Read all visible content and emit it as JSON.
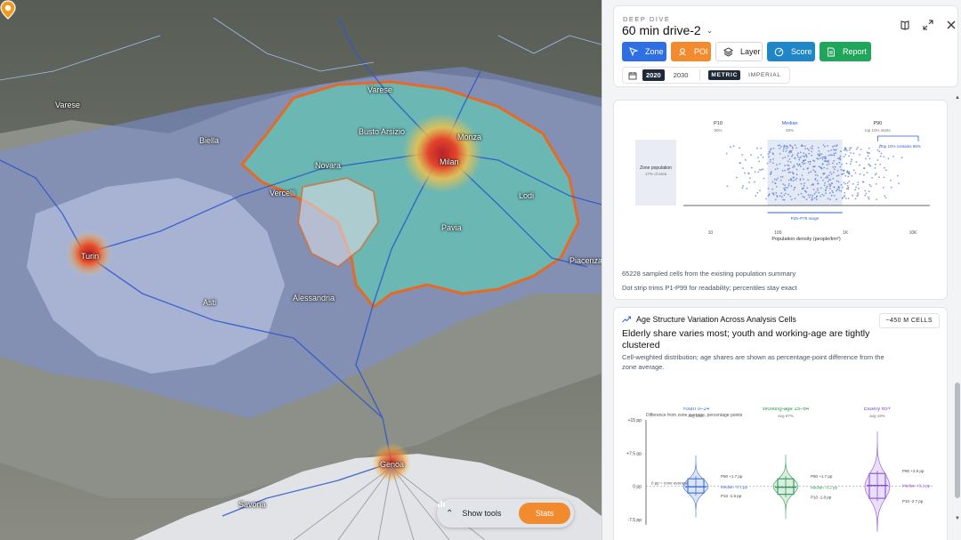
{
  "map": {
    "cities": [
      {
        "name": "Milan",
        "label": "Milan"
      },
      {
        "name": "Turin",
        "label": "Turin"
      },
      {
        "name": "Genoa",
        "label": "Genoa"
      },
      {
        "name": "Novara",
        "label": "Novara"
      },
      {
        "name": "Varese",
        "label": "Varese"
      },
      {
        "name": "Monza",
        "label": "Monza"
      },
      {
        "name": "Busto Arsizio",
        "label": "Busto Arsizio"
      },
      {
        "name": "Vercelli",
        "label": "Vercelli"
      },
      {
        "name": "Lodi",
        "label": "Lodi"
      },
      {
        "name": "Pavia",
        "label": "Pavia"
      },
      {
        "name": "Asti",
        "label": "Asti"
      },
      {
        "name": "Alessandria",
        "label": "Alessandria"
      },
      {
        "name": "Piacenza",
        "label": "Piacenza"
      },
      {
        "name": "Savona",
        "label": "Savona"
      },
      {
        "name": "Biella",
        "label": "Biella"
      },
      {
        "name": "Varese North",
        "label": "Varese"
      }
    ],
    "toolbar": {
      "show_tools": "Show tools",
      "stats": "Stats"
    }
  },
  "panel": {
    "eyebrow": "DEEP DIVE",
    "zone_name": "60 min drive-2",
    "buttons": [
      {
        "label": "Zone",
        "bg": "#2f6fe4",
        "fg": "#ffffff"
      },
      {
        "label": "POI",
        "bg": "#f28a2e",
        "fg": "#ffffff"
      },
      {
        "label": "Layer",
        "bg": "#ffffff",
        "fg": "#222222"
      },
      {
        "label": "Score",
        "bg": "#1f86c8",
        "fg": "#ffffff"
      },
      {
        "label": "Report",
        "bg": "#1fa65a",
        "fg": "#ffffff"
      }
    ],
    "years": {
      "active": "2020",
      "other": "2030"
    },
    "units": {
      "active": "METRIC",
      "other": "IMPERIAL"
    }
  },
  "density_card": {
    "note1": "65228 sampled cells from the existing population summary",
    "note2": "Dot strip trims P1-P99 for readability; percentiles stay exact",
    "chart_data": {
      "type": "scatter",
      "xlabel": "Population density (people/km²)",
      "x_scale": "log",
      "xticks": [
        "10",
        "100",
        "1K",
        "10K"
      ],
      "markers": [
        {
          "label": "P10",
          "sub": "50%"
        },
        {
          "label": "Median",
          "sub": "50%"
        },
        {
          "label": "P90",
          "sub": "top 10% starts"
        }
      ],
      "zone_population": {
        "label": "Zone population",
        "sub": "17% of area"
      },
      "top_note": "Top 10% contains 56%",
      "range_label": "P25–P75 range"
    }
  },
  "age_card": {
    "heading": "Age Structure Variation Across Analysis Cells",
    "badge": "~450 M CELLS",
    "title": "Elderly share varies most; youth and working-age are tightly clustered",
    "subtitle": "Cell-weighted distribution; age shares are shown as percentage-point difference from the zone average.",
    "chart_data": {
      "type": "violin",
      "caption": "Difference from zone average, percentage points",
      "yticks": [
        "+15 pp",
        "+7.5 pp",
        "0 pp",
        "-7.5 pp"
      ],
      "zero_label": "0 pp = zone average",
      "groups": [
        {
          "name": "Youth 0–14",
          "avg": "avg 14%",
          "color": "#3b6fd6",
          "p90": "P90 +1.7 pp",
          "median": "Median -0.1 pp",
          "p10": "P10 -1.5 pp",
          "p90_v": 1.7,
          "median_v": -0.1,
          "p10_v": -1.5
        },
        {
          "name": "Working-age 15–64",
          "avg": "avg 67%",
          "color": "#2f9a55",
          "p90": "P90 +1.7 pp",
          "median": "Median -0.2 pp",
          "p10": "P10 -1.8 pp",
          "p90_v": 1.7,
          "median_v": -0.2,
          "p10_v": -1.8
        },
        {
          "name": "Elderly 65+",
          "avg": "avg 19%",
          "color": "#8a4fd8",
          "p90": "P90 +2.9 pp",
          "median": "Median +0.2 pp",
          "p10": "P10 -2.7 pp",
          "p90_v": 2.9,
          "median_v": 0.2,
          "p10_v": -2.7
        }
      ]
    }
  }
}
